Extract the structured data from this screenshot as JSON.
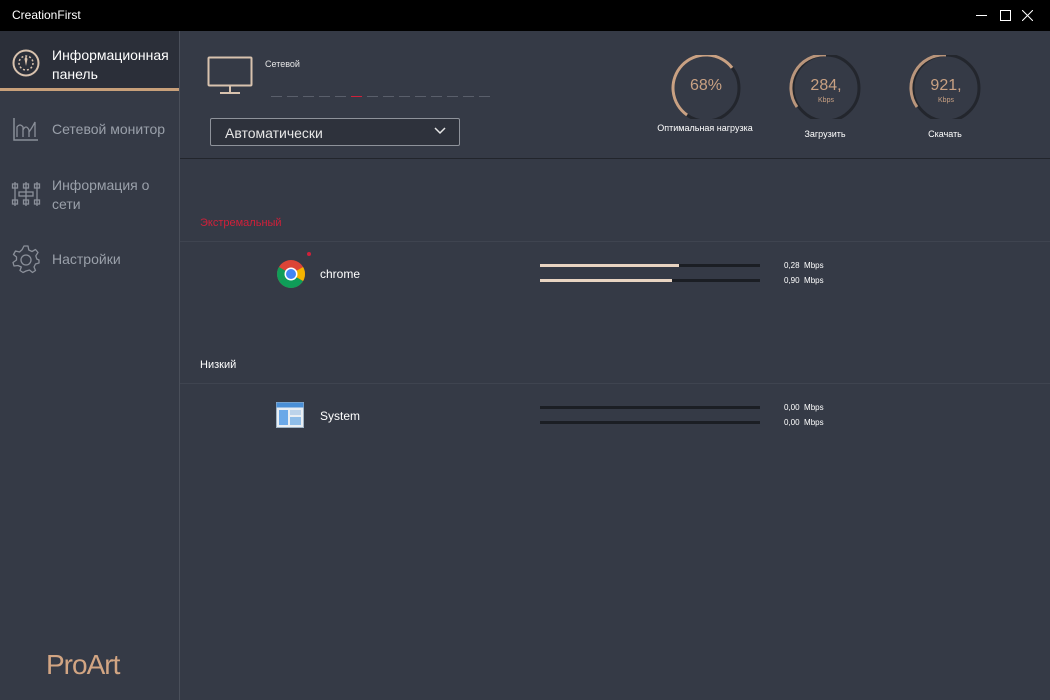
{
  "window": {
    "title": "CreationFirst"
  },
  "sidebar": {
    "items": [
      {
        "label": "Информационная панель",
        "icon": "gauge-icon",
        "active": true
      },
      {
        "label": "Сетевой монитор",
        "icon": "network-monitor-icon",
        "active": false
      },
      {
        "label": "Информация о сети",
        "icon": "network-info-icon",
        "active": false
      },
      {
        "label": "Настройки",
        "icon": "gear-icon",
        "active": false
      }
    ],
    "logo": "ProArt"
  },
  "header": {
    "connection_label": "Сетевой",
    "mode_dropdown": {
      "value": "Автоматически"
    },
    "gauges": [
      {
        "value": "68%",
        "unit": "",
        "caption": "Оптимальная нагрузка",
        "fraction": 0.68
      },
      {
        "value": "284,",
        "unit": "Kbps",
        "caption": "Загрузить"
      },
      {
        "value": "921,",
        "unit": "Kbps",
        "caption": "Скачать"
      }
    ]
  },
  "sections": [
    {
      "title": "Экстремальный",
      "title_color": "#d0203a",
      "apps": [
        {
          "name": "chrome",
          "icon": "chrome-icon",
          "upload": "0,28",
          "download": "0,90",
          "unit": "Mbps",
          "upload_fill": 0.63,
          "download_fill": 0.6
        }
      ]
    },
    {
      "title": "Низкий",
      "title_color": "#ffffff",
      "apps": [
        {
          "name": "System",
          "icon": "system-window-icon",
          "upload": "0,00",
          "download": "0,00",
          "unit": "Mbps",
          "upload_fill": 0,
          "download_fill": 0
        }
      ]
    }
  ],
  "colors": {
    "accent": "#c8a07a",
    "background": "#353a46",
    "extreme": "#d0203a"
  }
}
